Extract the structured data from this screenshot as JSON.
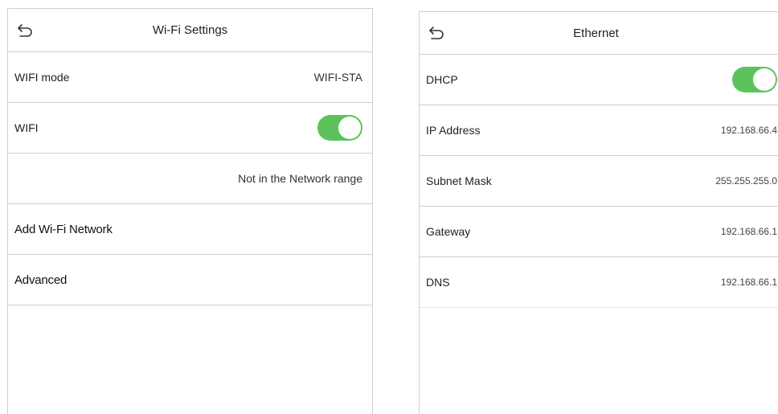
{
  "wifi": {
    "title": "Wi-Fi Settings",
    "mode_label": "WIFI mode",
    "mode_value": "WIFI-STA",
    "wifi_label": "WIFI",
    "wifi_enabled": true,
    "network_status": "Not in the Network range",
    "add_network_label": "Add Wi-Fi Network",
    "advanced_label": "Advanced"
  },
  "ethernet": {
    "title": "Ethernet",
    "dhcp_label": "DHCP",
    "dhcp_enabled": true,
    "ip_label": "IP Address",
    "ip_value": "192.168.66.4",
    "subnet_label": "Subnet Mask",
    "subnet_value": "255.255.255.0",
    "gateway_label": "Gateway",
    "gateway_value": "192.168.66.1",
    "dns_label": "DNS",
    "dns_value": "192.168.66.1"
  },
  "colors": {
    "toggle_on": "#5cc35c",
    "divider": "#cfcfcf"
  },
  "icons": {
    "back": "back-arrow-icon",
    "toggle": "toggle-switch"
  }
}
